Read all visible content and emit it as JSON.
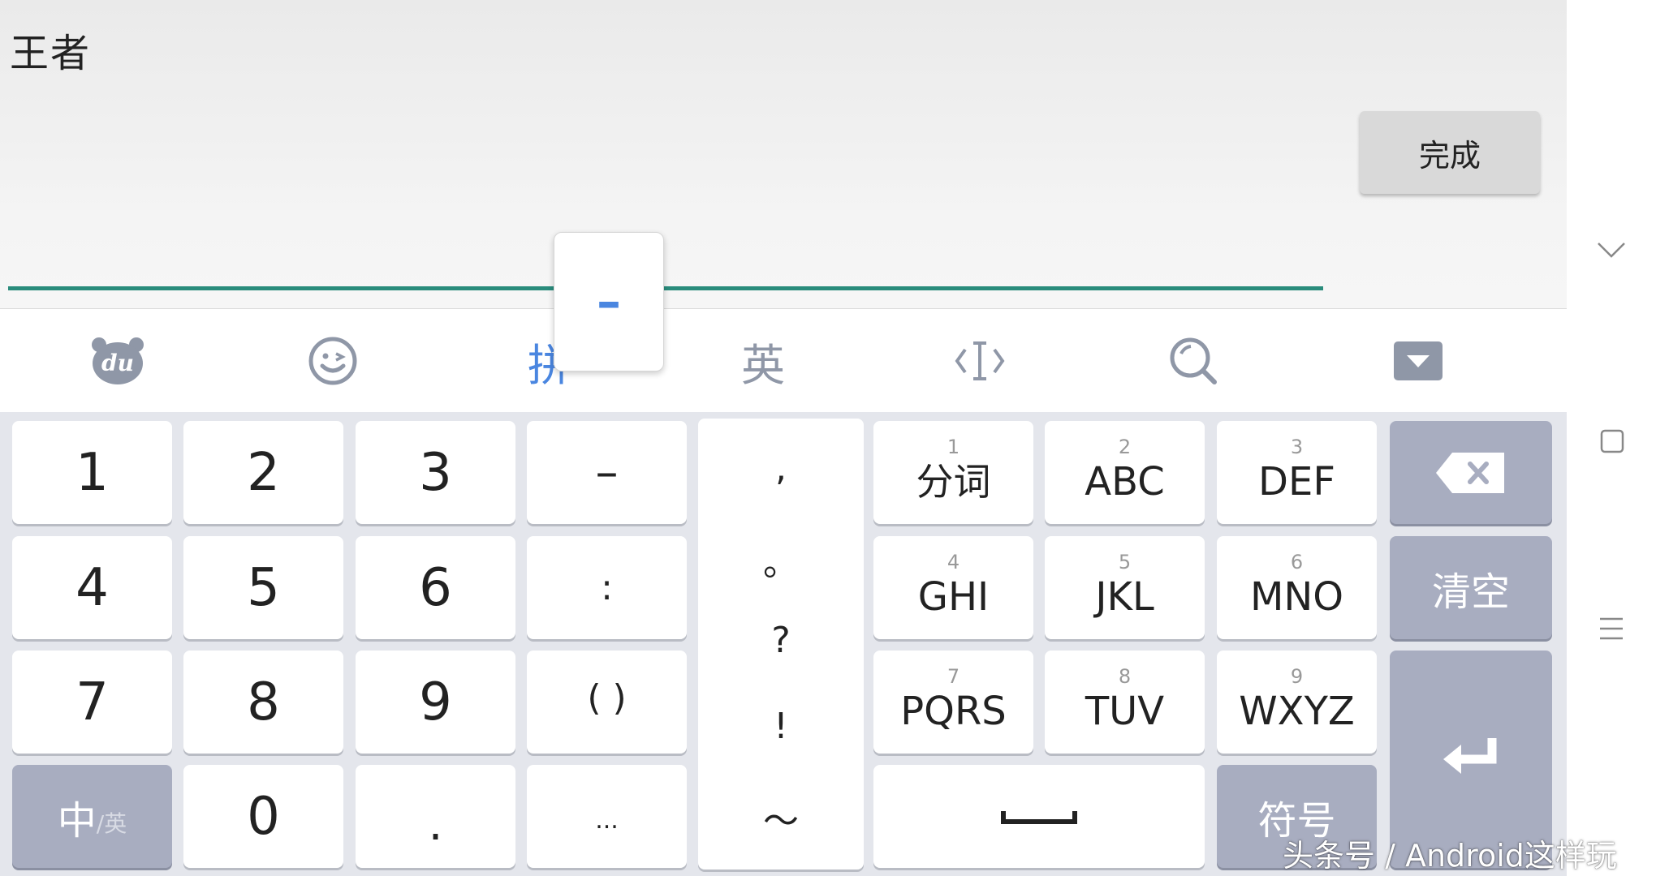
{
  "input": {
    "text": "王者",
    "done_label": "完成",
    "preview_char": "–"
  },
  "toolbar": {
    "baidu_icon": "baidu-du-bear-icon",
    "emoji_icon": "smiley-emoji-icon",
    "pinyin_label": "拼",
    "english_label": "英",
    "cursor_icon": "cursor-move-icon",
    "search_icon": "search-icon",
    "hide_icon": "hide-keyboard-icon"
  },
  "keys": {
    "row1": [
      "1",
      "2",
      "3",
      "–"
    ],
    "row2": [
      "4",
      "5",
      "6",
      ":"
    ],
    "row3": [
      "7",
      "8",
      "9",
      "( )"
    ],
    "row4": {
      "lang": "中",
      "lang_small": "/英",
      "zero": "0",
      "dot": ".",
      "ellipsis": "..."
    },
    "punct_column": [
      ",",
      "。",
      "?",
      "!",
      "～"
    ],
    "t9": [
      {
        "num": "1",
        "label": "分词"
      },
      {
        "num": "2",
        "label": "ABC"
      },
      {
        "num": "3",
        "label": "DEF"
      },
      {
        "num": "4",
        "label": "GHI"
      },
      {
        "num": "5",
        "label": "JKL"
      },
      {
        "num": "6",
        "label": "MNO"
      },
      {
        "num": "7",
        "label": "PQRS"
      },
      {
        "num": "8",
        "label": "TUV"
      },
      {
        "num": "9",
        "label": "WXYZ"
      }
    ],
    "clear_label": "清空",
    "symbols_label": "符号"
  },
  "watermark": "头条号 / Android这样玩",
  "colors": {
    "accent_blue": "#4a86e0",
    "underline_teal": "#2a8c7c",
    "function_key": "#a8adc0",
    "keyboard_bg": "#e4e6ec",
    "toolbar_icon": "#8f97a7"
  }
}
